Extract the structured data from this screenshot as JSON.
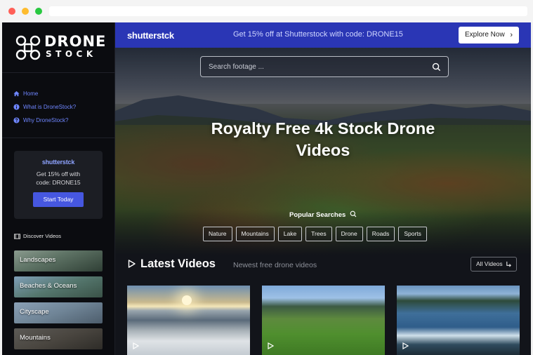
{
  "sidebar": {
    "logo": {
      "line1": "DRONE",
      "line2": "STOCK"
    },
    "nav": [
      {
        "label": "Home",
        "icon": "home-icon"
      },
      {
        "label": "What is DroneStock?",
        "icon": "info-icon"
      },
      {
        "label": "Why DroneStock?",
        "icon": "question-icon"
      }
    ],
    "promo": {
      "brand": "shutterstck",
      "text_line1": "Get 15% off with",
      "text_line2": "code: DRONE15",
      "button": "Start Today"
    },
    "discover_label": "Discover Videos",
    "categories": [
      {
        "label": "Landscapes"
      },
      {
        "label": "Beaches & Oceans"
      },
      {
        "label": "Cityscape"
      },
      {
        "label": "Mountains"
      }
    ]
  },
  "banner": {
    "logo": "shutterstck",
    "message": "Get 15% off at Shutterstock with code: DRONE15",
    "cta": "Explore Now",
    "color": "#2a36b5"
  },
  "hero": {
    "search_placeholder": "Search footage ...",
    "title_line1": "Royalty Free 4k Stock Drone",
    "title_line2": "Videos",
    "popular_label": "Popular Searches",
    "tags": [
      "Nature",
      "Mountains",
      "Lake",
      "Trees",
      "Drone",
      "Roads",
      "Sports"
    ]
  },
  "latest": {
    "title": "Latest Videos",
    "subtitle": "Newest free drone videos",
    "all_button": "All Videos"
  },
  "colors": {
    "accent": "#4657e0",
    "link": "#6f86ff",
    "background": "#12141a"
  }
}
